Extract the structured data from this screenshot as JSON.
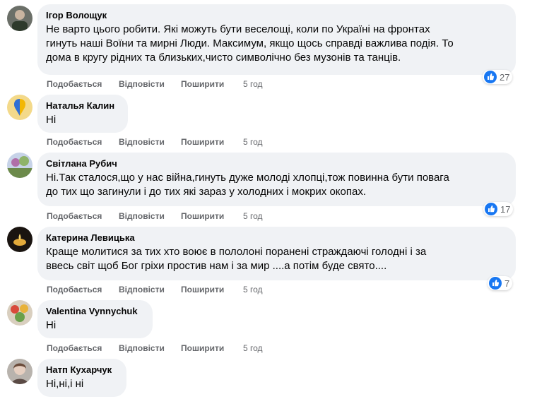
{
  "actions": {
    "like": "Подобається",
    "reply": "Відповісти",
    "share": "Поширити"
  },
  "comments": [
    {
      "author": "Ігор Волощук",
      "lines": [
        "Не варто цього робити. Які можуть бути веселощі, коли по Україні на фронтах",
        "гинуть наші Воїни та мирні Люди. Максимум, якщо щось справді важлива подія. То",
        "дома в кругу рідних та близьких,чисто символічно без музонів та танців."
      ],
      "time": "5 год",
      "reactions": "27"
    },
    {
      "author": "Наталья Калин",
      "lines": [
        "Ні"
      ],
      "time": "5 год"
    },
    {
      "author": "Світлана Рубич",
      "lines": [
        "Ні.Так сталося,що у нас війна,гинуть дуже молоді хлопці,тож повинна бути повага",
        "до тих що загинули і до тих які зараз у холодних і мокрих окопах."
      ],
      "time": "5 год",
      "reactions": "17"
    },
    {
      "author": "Катерина Левицька",
      "lines": [
        "Краще молитися за тих хто воює в пололоні поранені страждаючі голодні і за",
        "ввесь світ щоб Бог гріхи простив нам і за мир ....а потім буде свято...."
      ],
      "time": "5 год",
      "reactions": "7"
    },
    {
      "author": "Valentina Vynnychuk",
      "lines": [
        "Ні"
      ],
      "time": "5 год"
    },
    {
      "author": "Натп Кухарчук",
      "lines": [
        "Ні,ні,і ні"
      ]
    }
  ]
}
